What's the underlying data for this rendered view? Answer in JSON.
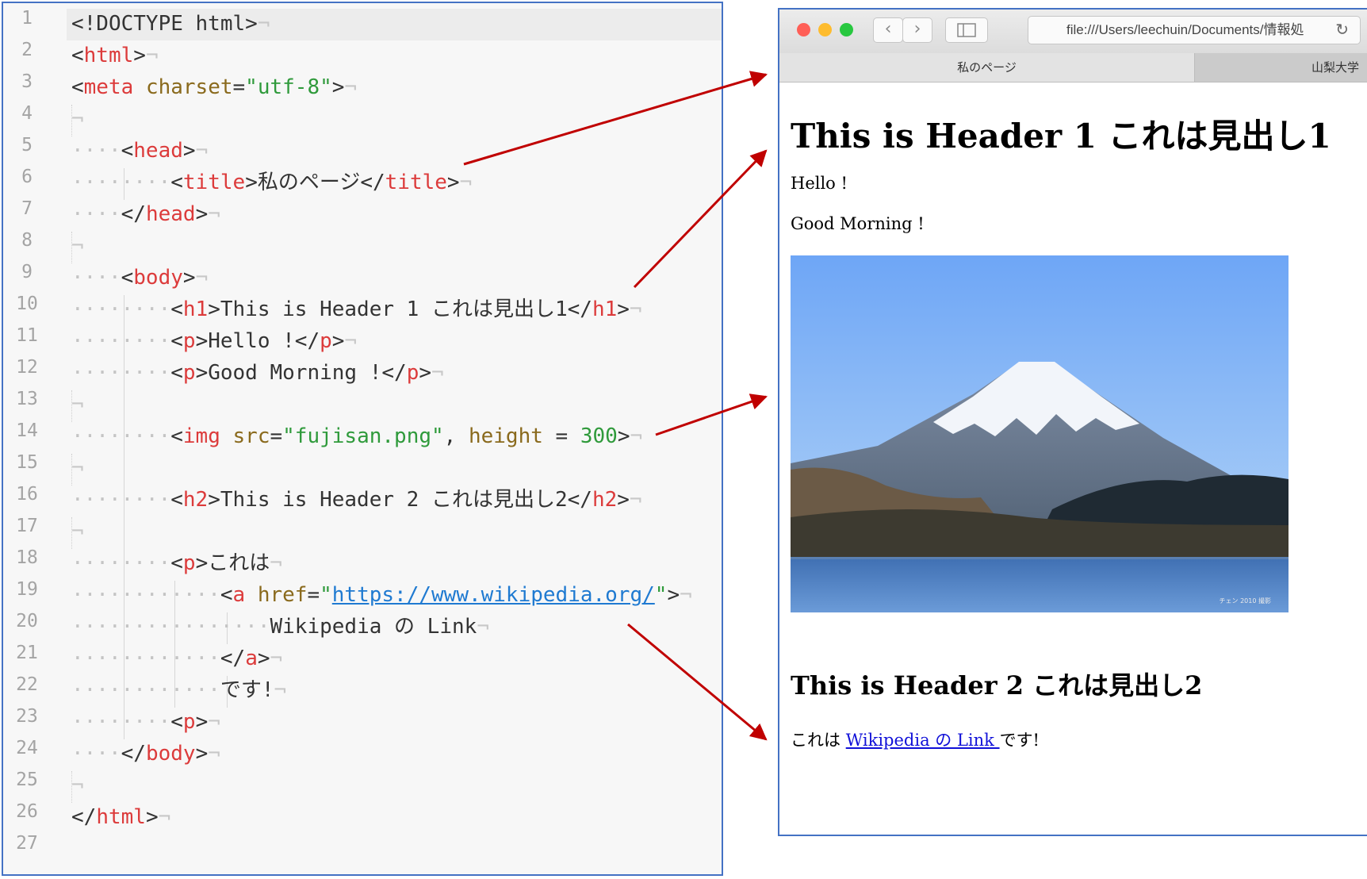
{
  "editor": {
    "line_numbers": [
      "1",
      "2",
      "3",
      "4",
      "5",
      "6",
      "7",
      "8",
      "9",
      "10",
      "11",
      "12",
      "13",
      "14",
      "15",
      "16",
      "17",
      "18",
      "19",
      "20",
      "21",
      "22",
      "23",
      "24",
      "25",
      "26",
      "27"
    ],
    "code": {
      "l1_doctype": "<!DOCTYPE html>",
      "l2_open": "<",
      "l2_tag": "html",
      "l2_close": ">",
      "l3_open": "<",
      "l3_tag": "meta",
      "l3_attr": "charset",
      "l3_eq": "=",
      "l3_val": "\"utf-8\"",
      "l3_close": ">",
      "l5_open": "<",
      "l5_tag": "head",
      "l5_close": ">",
      "l6_open": "<",
      "l6_tag": "title",
      "l6_mid1": ">",
      "l6_text": "私のページ",
      "l6_mid2": "</",
      "l6_tag2": "title",
      "l6_close": ">",
      "l7_open": "</",
      "l7_tag": "head",
      "l7_close": ">",
      "l9_open": "<",
      "l9_tag": "body",
      "l9_close": ">",
      "l10_open": "<",
      "l10_tag": "h1",
      "l10_mid1": ">",
      "l10_text": "This is Header 1 これは見出し1",
      "l10_mid2": "</",
      "l10_tag2": "h1",
      "l10_close": ">",
      "l11_open": "<",
      "l11_tag": "p",
      "l11_mid1": ">",
      "l11_text": "Hello !",
      "l11_mid2": "</",
      "l11_tag2": "p",
      "l11_close": ">",
      "l12_open": "<",
      "l12_tag": "p",
      "l12_mid1": ">",
      "l12_text": "Good Morning !",
      "l12_mid2": "</",
      "l12_tag2": "p",
      "l12_close": ">",
      "l14_open": "<",
      "l14_tag": "img",
      "l14_attr1": "src",
      "l14_eq1": "=",
      "l14_val1": "\"fujisan.png\"",
      "l14_comma": ", ",
      "l14_attr2": "height",
      "l14_eq2": " = ",
      "l14_val2": "300",
      "l14_close": ">",
      "l16_open": "<",
      "l16_tag": "h2",
      "l16_mid1": ">",
      "l16_text": "This is Header 2 これは見出し2",
      "l16_mid2": "</",
      "l16_tag2": "h2",
      "l16_close": ">",
      "l18_open": "<",
      "l18_tag": "p",
      "l18_mid1": ">",
      "l18_text": "これは",
      "l19_open": "<",
      "l19_tag": "a",
      "l19_attr": "href",
      "l19_eq": "=",
      "l19_q1": "\"",
      "l19_url": "https://www.wikipedia.org/",
      "l19_q2": "\"",
      "l19_close": ">",
      "l20_text": "Wikipedia の Link",
      "l21_open": "</",
      "l21_tag": "a",
      "l21_close": ">",
      "l22_text": "です!",
      "l23_open": "<",
      "l23_tag": "p",
      "l23_close": ">",
      "l24_open": "</",
      "l24_tag": "body",
      "l24_close": ">",
      "l26_open": "</",
      "l26_tag": "html",
      "l26_close": ">",
      "eol": "¬",
      "dot4": "····",
      "dot2": "··",
      "dot3": "···"
    }
  },
  "browser": {
    "url": "file:///Users/leechuin/Documents/情報処",
    "tabs": [
      "私のページ",
      "山梨大学"
    ],
    "buttons": {
      "back": "‹",
      "forward": "›",
      "reload": "↻"
    },
    "page": {
      "h1": "This is Header 1 これは見出し1",
      "p1": "Hello !",
      "p2": "Good Morning !",
      "photo_credit": "チェン 2010 撮影",
      "h2": "This is Header 2 これは見出し2",
      "p3_before": "これは ",
      "p3_link": "Wikipedia の Link ",
      "p3_after": "です!"
    },
    "traffic_light_colors": [
      "#ff5f57",
      "#febc2e",
      "#28c840"
    ]
  },
  "colors": {
    "frame": "#4472c4",
    "arrow": "#c00000",
    "tag": "#dc3b3b",
    "attr": "#8a6a1d",
    "string": "#2f9a3b",
    "link": "#1010d8"
  }
}
